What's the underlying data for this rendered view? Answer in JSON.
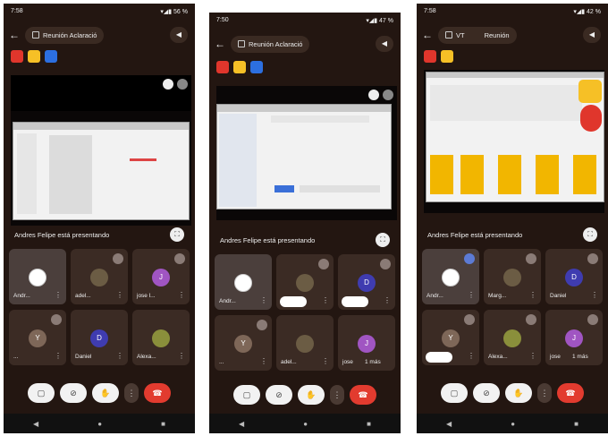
{
  "p1": {
    "status_time": "7:58",
    "status_icons": "▾◢▮ 56 %",
    "title": "Reunión Aclaració",
    "caption": "Andres Felipe está presentando",
    "tiles": [
      {
        "name": "Andr..."
      },
      {
        "name": "adel..."
      },
      {
        "name": "jose l..."
      },
      {
        "name": "..."
      },
      {
        "name": "Daniel"
      },
      {
        "name": "Alexa..."
      }
    ]
  },
  "p2": {
    "status_time": "7:50",
    "status_icons": "▾◢▮ 47 %",
    "title": "Reunión Aclaració",
    "caption": "Andres Felipe está presentando",
    "tiles": [
      {
        "name": "Andr..."
      },
      {
        "name": ""
      },
      {
        "name": ""
      },
      {
        "name": "..."
      },
      {
        "name": "adel..."
      },
      {
        "name": "jose",
        "extra": "1 más"
      }
    ]
  },
  "p3": {
    "status_time": "7:58",
    "status_icons": "▾◢▮ 42 %",
    "title_a": "VT",
    "title_b": "Reunión",
    "caption": "Andres Felipe está presentando",
    "tiles": [
      {
        "name": "Andr..."
      },
      {
        "name": "Marg..."
      },
      {
        "name": "Daniel"
      },
      {
        "name": ""
      },
      {
        "name": "Alexa..."
      },
      {
        "name": "jose",
        "extra": "1 más"
      }
    ]
  },
  "icons": {
    "back": "←",
    "speaker": "◀",
    "fullscreen": "⛶",
    "more": "⋮",
    "nav_back": "◀",
    "nav_home": "●",
    "nav_recent": "■"
  },
  "colors": {
    "end_call": "#e23b2f",
    "bg": "#231611"
  }
}
